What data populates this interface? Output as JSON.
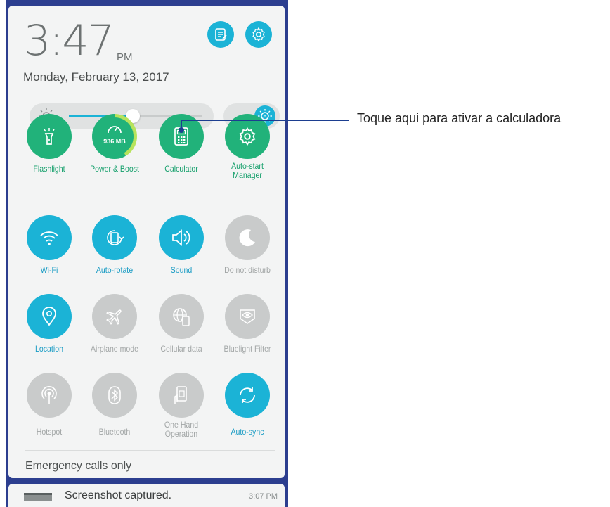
{
  "status": {
    "time": "3:47",
    "ampm": "PM",
    "date": "Monday, February 13, 2017"
  },
  "header_buttons": [
    {
      "icon": "notes-icon"
    },
    {
      "icon": "settings-gear-icon"
    }
  ],
  "brightness": {
    "level": 0.48,
    "auto_icon": "auto-brightness-icon"
  },
  "tiles": [
    {
      "label": "Flashlight",
      "state": "green",
      "icon": "flashlight-icon"
    },
    {
      "label": "Power & Boost",
      "state": "green",
      "icon": "speedometer-icon",
      "badge": "936 MB"
    },
    {
      "label": "Calculator",
      "state": "green",
      "icon": "calculator-icon"
    },
    {
      "label": "Auto-start Manager",
      "state": "green",
      "icon": "gear-icon"
    },
    {
      "label": "Wi-Fi",
      "state": "blue",
      "icon": "wifi-icon"
    },
    {
      "label": "Auto-rotate",
      "state": "blue",
      "icon": "rotate-icon"
    },
    {
      "label": "Sound",
      "state": "blue",
      "icon": "speaker-icon"
    },
    {
      "label": "Do not disturb",
      "state": "gray",
      "icon": "moon-icon"
    },
    {
      "label": "Location",
      "state": "blue",
      "icon": "location-pin-icon"
    },
    {
      "label": "Airplane mode",
      "state": "gray",
      "icon": "airplane-icon"
    },
    {
      "label": "Cellular data",
      "state": "gray",
      "icon": "globe-icon"
    },
    {
      "label": "Bluelight Filter",
      "state": "gray",
      "icon": "eye-icon"
    },
    {
      "label": "Hotspot",
      "state": "gray",
      "icon": "hotspot-icon"
    },
    {
      "label": "Bluetooth",
      "state": "gray",
      "icon": "bluetooth-icon"
    },
    {
      "label": "One Hand Operation",
      "state": "gray",
      "icon": "one-hand-icon"
    },
    {
      "label": "Auto-sync",
      "state": "blue",
      "icon": "sync-icon"
    }
  ],
  "emergency_text": "Emergency calls only",
  "notification": {
    "text": "Screenshot captured.",
    "time": "3:07 PM"
  },
  "callout": "Toque aqui para ativar a calculadora",
  "colors": {
    "green": "#21b27a",
    "blue": "#1bb3d6",
    "gray": "#c9cbcb",
    "frame": "#2c3e8f"
  }
}
